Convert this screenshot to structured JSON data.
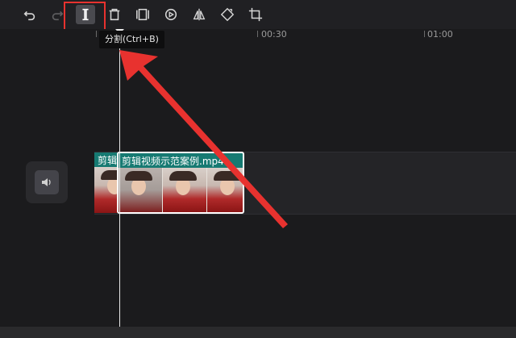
{
  "toolbar": {
    "tools": [
      {
        "id": "undo",
        "icon": "undo-icon",
        "state": "normal"
      },
      {
        "id": "redo",
        "icon": "redo-icon",
        "state": "disabled"
      },
      {
        "id": "split",
        "icon": "split-icon",
        "state": "active"
      },
      {
        "id": "delete",
        "icon": "trash-icon",
        "state": "normal"
      },
      {
        "id": "freeze",
        "icon": "freeze-frame-icon",
        "state": "normal"
      },
      {
        "id": "reverse",
        "icon": "reverse-play-icon",
        "state": "normal"
      },
      {
        "id": "mirror",
        "icon": "mirror-icon",
        "state": "normal"
      },
      {
        "id": "rotate",
        "icon": "rotate-icon",
        "state": "normal"
      },
      {
        "id": "crop",
        "icon": "crop-icon",
        "state": "normal"
      }
    ],
    "tooltip": "分割(Ctrl+B)"
  },
  "ruler": {
    "labels": [
      "00:30",
      "01:00"
    ]
  },
  "track": {
    "icon": "audio-muted-speaker-icon",
    "clip_left_title": "剪辑",
    "clip_main_title": "剪辑视频示范案例.mp4"
  },
  "colors": {
    "background": "#1b1b1d",
    "clip_teal": "#167a72",
    "highlight_red": "#e8322f"
  }
}
